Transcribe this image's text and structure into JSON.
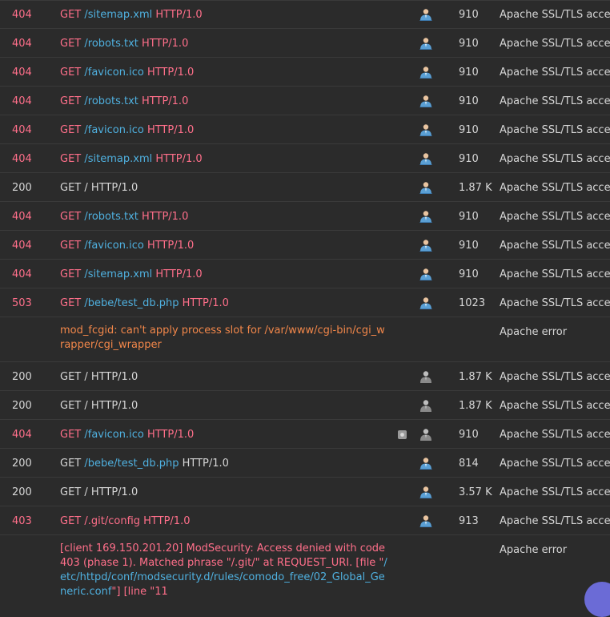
{
  "rows": [
    {
      "status": "404",
      "method": "GET",
      "path": "/sitemap.xml",
      "proto": "HTTP/1.0",
      "size": "910",
      "source": "Apache SSL/TLS access"
    },
    {
      "status": "404",
      "method": "GET",
      "path": "/robots.txt",
      "proto": "HTTP/1.0",
      "size": "910",
      "source": "Apache SSL/TLS access"
    },
    {
      "status": "404",
      "method": "GET",
      "path": "/favicon.ico",
      "proto": "HTTP/1.0",
      "size": "910",
      "source": "Apache SSL/TLS access"
    },
    {
      "status": "404",
      "method": "GET",
      "path": "/robots.txt",
      "proto": "HTTP/1.0",
      "size": "910",
      "source": "Apache SSL/TLS access"
    },
    {
      "status": "404",
      "method": "GET",
      "path": "/favicon.ico",
      "proto": "HTTP/1.0",
      "size": "910",
      "source": "Apache SSL/TLS access"
    },
    {
      "status": "404",
      "method": "GET",
      "path": "/sitemap.xml",
      "proto": "HTTP/1.0",
      "size": "910",
      "source": "Apache SSL/TLS access"
    },
    {
      "status": "200",
      "method": "GET",
      "path": "/",
      "proto": "HTTP/1.0",
      "size": "1.87 K",
      "source": "Apache SSL/TLS access"
    },
    {
      "status": "404",
      "method": "GET",
      "path": "/robots.txt",
      "proto": "HTTP/1.0",
      "size": "910",
      "source": "Apache SSL/TLS access"
    },
    {
      "status": "404",
      "method": "GET",
      "path": "/favicon.ico",
      "proto": "HTTP/1.0",
      "size": "910",
      "source": "Apache SSL/TLS access"
    },
    {
      "status": "404",
      "method": "GET",
      "path": "/sitemap.xml",
      "proto": "HTTP/1.0",
      "size": "910",
      "source": "Apache SSL/TLS access"
    },
    {
      "status": "503",
      "method": "GET",
      "path": "/bebe/test_db.php",
      "proto": "HTTP/1.0",
      "size": "1023",
      "source": "Apache SSL/TLS access"
    },
    {
      "error": "mod_fcgid: can't apply process slot for /var/www/cgi-bin/cgi_wrapper/cgi_wrapper",
      "source": "Apache error"
    },
    {
      "status": "200",
      "method": "GET",
      "path": "/",
      "proto": "HTTP/1.0",
      "size": "1.87 K",
      "source": "Apache SSL/TLS access"
    },
    {
      "status": "200",
      "method": "GET",
      "path": "/",
      "proto": "HTTP/1.0",
      "size": "1.87 K",
      "source": "Apache SSL/TLS access"
    },
    {
      "status": "404",
      "method": "GET",
      "path": "/favicon.ico",
      "proto": "HTTP/1.0",
      "size": "910",
      "source": "Apache SSL/TLS access"
    },
    {
      "status": "200",
      "method": "GET",
      "path": "/bebe/test_db.php",
      "proto": "HTTP/1.0",
      "size": "814",
      "source": "Apache SSL/TLS access"
    },
    {
      "status": "200",
      "method": "GET",
      "path": "/",
      "proto": "HTTP/1.0",
      "size": "3.57 K",
      "source": "Apache SSL/TLS access"
    },
    {
      "status": "403",
      "method": "GET",
      "path": "/.git/config",
      "proto": "HTTP/1.0",
      "size": "913",
      "source": "Apache SSL/TLS access"
    },
    {
      "modsec_parts": [
        "[client 169.150.201.20] ModSecurity: Access denied with code 403 (phase 1). Matched phrase \"/.git/\" at REQUEST_URI. [file \"",
        "/etc/httpd/conf/modsecurity.d/rules/comodo_free/02_Global_Generic.conf",
        "\"] [line \"11"
      ],
      "source": "Apache error"
    }
  ],
  "colors": {
    "background": "#2b2b2b",
    "error_status": "#ff6f8a",
    "ok_status": "#d6d6d6",
    "path": "#4fb0df",
    "warning": "#f2874a"
  },
  "icons": {
    "user": "user-icon",
    "shield": "shield-icon"
  }
}
